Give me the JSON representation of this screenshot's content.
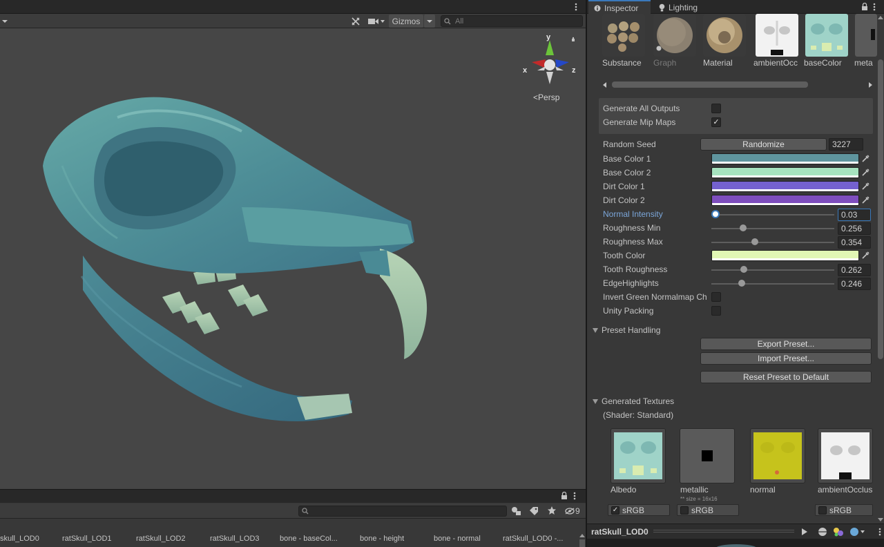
{
  "scene": {
    "gizmos_label": "Gizmos",
    "search_placeholder": "All",
    "persp_label": "Persp",
    "axis_x": "x",
    "axis_y": "y",
    "axis_z": "z"
  },
  "project": {
    "hidden_count": "9",
    "files": [
      "skull_LOD0",
      "ratSkull_LOD1",
      "ratSkull_LOD2",
      "ratSkull_LOD3",
      "bone - baseCol...",
      "bone - height",
      "bone - normal",
      "ratSkull_LOD0 -..."
    ]
  },
  "inspector": {
    "tabs": [
      {
        "label": "Inspector",
        "active": true
      },
      {
        "label": "Lighting",
        "active": false
      }
    ],
    "outputs": [
      {
        "label": "Substance"
      },
      {
        "label": "Graph"
      },
      {
        "label": "Material"
      },
      {
        "label": "ambientOcc"
      },
      {
        "label": "baseColor"
      },
      {
        "label": "meta"
      }
    ],
    "generate_all_outputs": {
      "label": "Generate All Outputs",
      "checked": false
    },
    "generate_mip_maps": {
      "label": "Generate Mip Maps",
      "checked": true
    },
    "random_seed": {
      "label": "Random Seed",
      "button": "Randomize",
      "value": "3227"
    },
    "colors": [
      {
        "label": "Base Color 1",
        "color": "#5f959e"
      },
      {
        "label": "Base Color 2",
        "color": "#a6e3bf"
      },
      {
        "label": "Dirt Color 1",
        "color": "#7461cf"
      },
      {
        "label": "Dirt Color 2",
        "color": "#7e4ebd"
      }
    ],
    "sliders": [
      {
        "label": "Normal Intensity",
        "value": "0.03",
        "fraction": 0.0,
        "active": true
      },
      {
        "label": "Roughness Min",
        "value": "0.256",
        "fraction": 0.256
      },
      {
        "label": "Roughness Max",
        "value": "0.354",
        "fraction": 0.354
      }
    ],
    "tooth_color": {
      "label": "Tooth Color",
      "color": "#e1f7b4"
    },
    "sliders2": [
      {
        "label": "Tooth Roughness",
        "value": "0.262",
        "fraction": 0.262
      },
      {
        "label": "EdgeHighlights",
        "value": "0.246",
        "fraction": 0.246
      }
    ],
    "invert_green": {
      "label": "Invert Green Normalmap Ch",
      "checked": false
    },
    "unity_packing": {
      "label": "Unity Packing",
      "checked": false
    },
    "preset_handling": {
      "title": "Preset Handling",
      "export": "Export Preset...",
      "import": "Import Preset...",
      "reset": "Reset Preset to Default"
    },
    "generated_textures": {
      "title": "Generated Textures",
      "shader": "(Shader: Standard)",
      "textures": [
        {
          "label": "Albedo",
          "srgb_label": "sRGB",
          "srgb": true
        },
        {
          "label": "metallic",
          "srgb_label": "sRGB",
          "srgb": false,
          "note": "** size = 16x16"
        },
        {
          "label": "normal",
          "srgb_label": "",
          "srgb": false
        },
        {
          "label": "ambientOcclus",
          "srgb_label": "sRGB",
          "srgb": false
        }
      ]
    },
    "preview": {
      "object_name": "ratSkull_LOD0"
    }
  }
}
